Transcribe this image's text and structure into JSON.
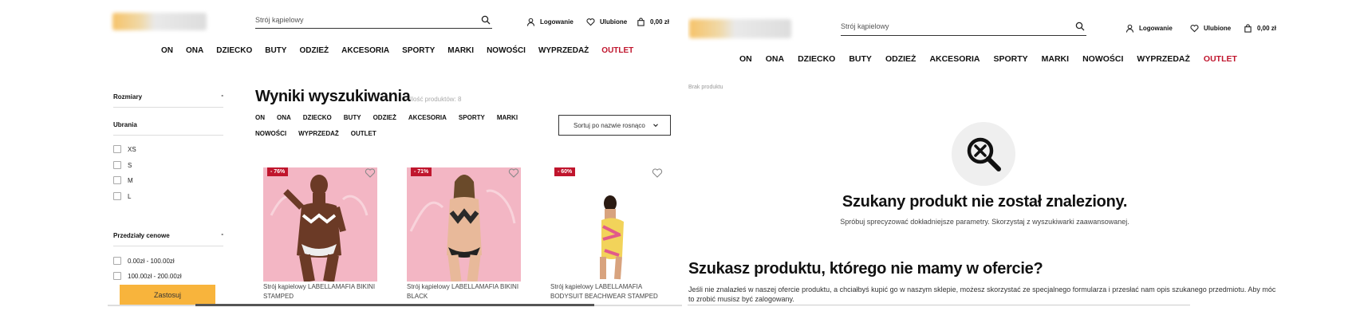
{
  "header": {
    "search_placeholder": "Strój kąpielowy",
    "login_label": "Logowanie",
    "favorites_label": "Ulubione",
    "cart_total": "0,00 zł"
  },
  "nav": [
    "ON",
    "ONA",
    "DZIECKO",
    "BUTY",
    "ODZIEŻ",
    "AKCESORIA",
    "SPORTY",
    "MARKI",
    "NOWOŚCI",
    "WYPRZEDAŻ",
    "OUTLET"
  ],
  "sidebar": {
    "sizes_title": "Rozmiary",
    "sizes_toggle": "-",
    "clothing_title": "Ubrania",
    "size_options": [
      "XS",
      "S",
      "M",
      "L"
    ],
    "price_title": "Przedziały cenowe",
    "price_toggle": "-",
    "price_options": [
      "0.00zł - 100.00zł",
      "100.00zł - 200.00zł"
    ],
    "apply_label": "Zastosuj"
  },
  "results": {
    "title": "Wyniki wyszukiwania",
    "count": "Ilość produktów: 8",
    "categories": [
      "ON",
      "ONA",
      "DZIECKO",
      "BUTY",
      "ODZIEŻ",
      "AKCESORIA",
      "SPORTY",
      "MARKI",
      "NOWOŚCI",
      "WYPRZEDAŻ",
      "OUTLET"
    ],
    "sort_label": "Sortuj po nazwie rosnąco",
    "products": [
      {
        "discount": "- 76%",
        "name": "Strój kąpielowy LABELLAMAFIA BIKINI STAMPED"
      },
      {
        "discount": "- 71%",
        "name": "Strój kąpielowy LABELLAMAFIA BIKINI BLACK"
      },
      {
        "discount": "- 60%",
        "name": "Strój kąpielowy LABELLAMAFIA BODYSUIT BEACHWEAR STAMPED"
      }
    ]
  },
  "not_found": {
    "breadcrumb": "Brak produktu",
    "title": "Szukany produkt nie został znaleziony.",
    "subtitle": "Spróbuj sprecyzować dokładniejsze parametry. Skorzystaj z wyszukiwarki zaawansowanej.",
    "missing_title": "Szukasz produktu, którego nie mamy w ofercie?",
    "missing_text": "Jeśli nie znalazłeś w naszej ofercie produktu, a chciałbyś kupić go w naszym sklepie, możesz skorzystać ze specjalnego formularza i przesłać nam opis szukanego przedmiotu. Aby móc to zrobić musisz być zalogowany."
  },
  "colors": {
    "accent": "#f8b43c",
    "outlet": "#c0152d",
    "product_bg": "#f3b6c4"
  }
}
